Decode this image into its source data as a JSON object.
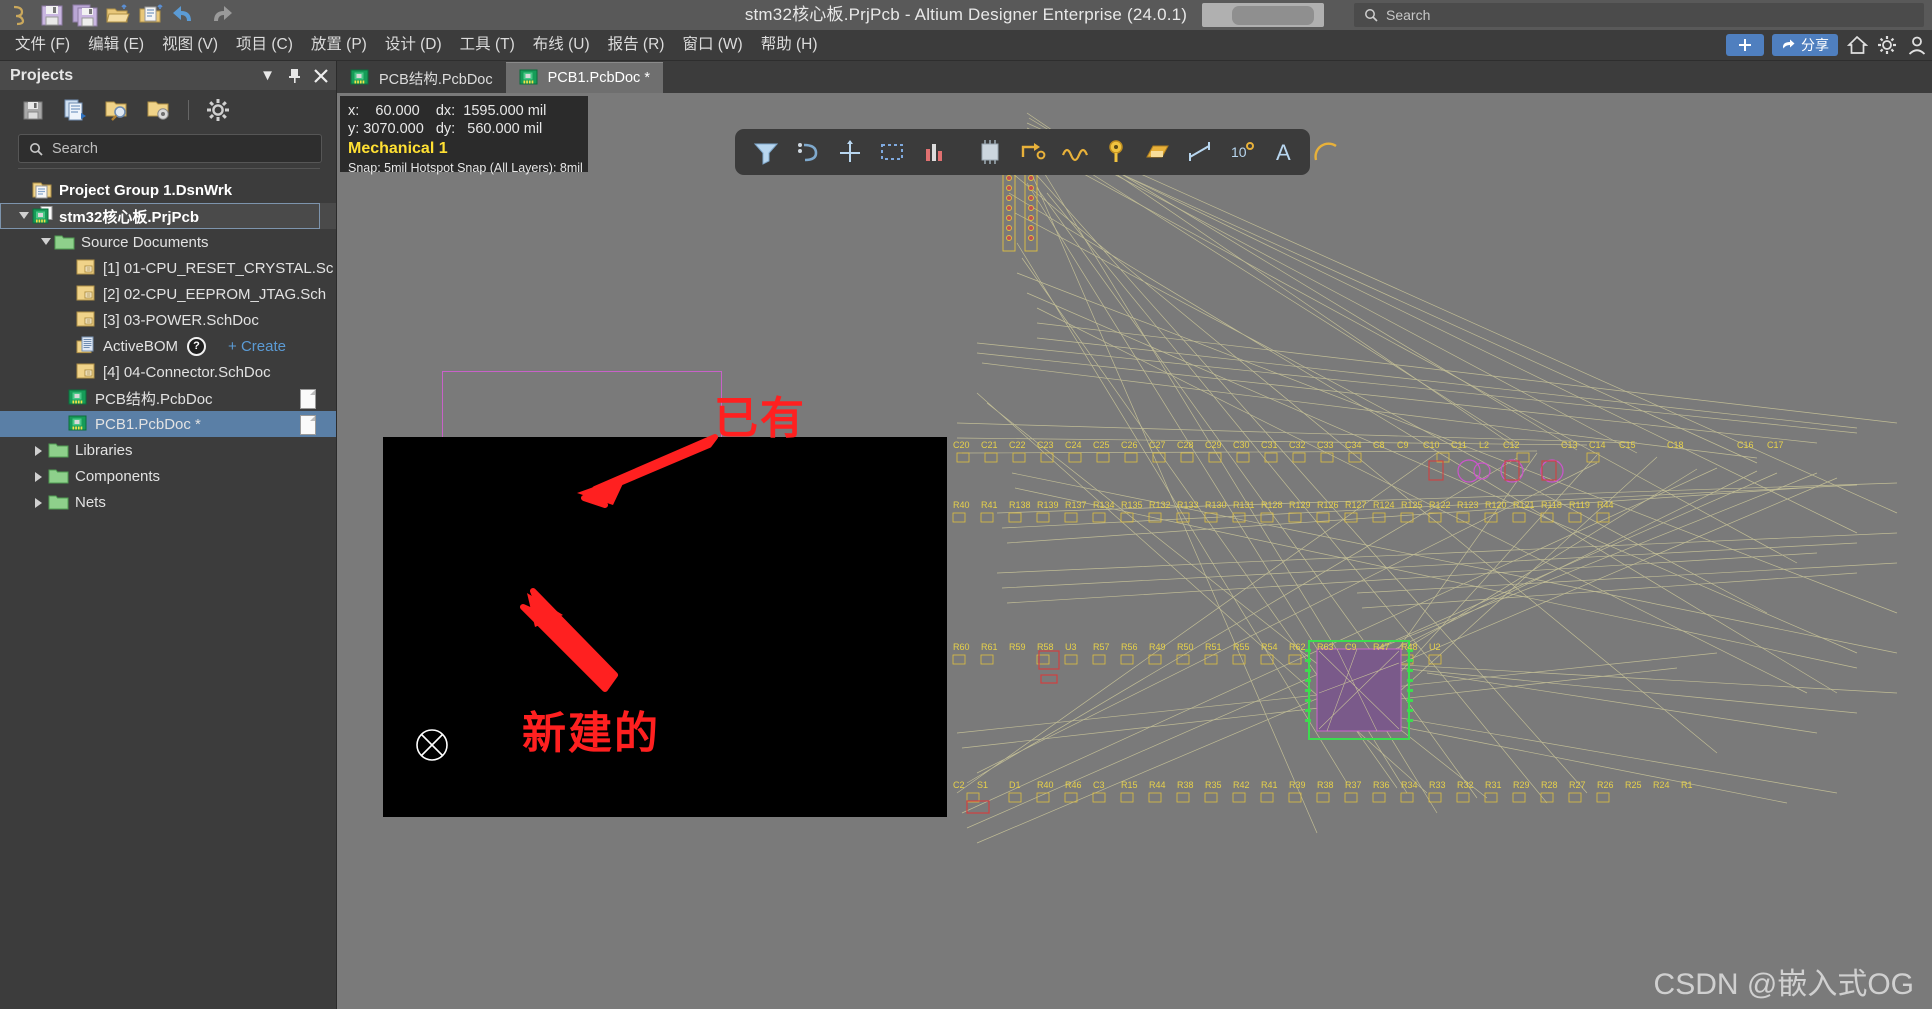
{
  "window": {
    "title": "stm32核心板.PrjPcb - Altium Designer Enterprise (24.0.1)",
    "search_placeholder": "Search"
  },
  "toolbar_top": {
    "icons": [
      "altium-logo-icon",
      "save-icon",
      "save-all-icon",
      "open-folder-icon",
      "open-document-icon",
      "undo-icon",
      "redo-icon"
    ]
  },
  "menu": {
    "items": [
      {
        "label": "文件 (F)",
        "name": "menu-file"
      },
      {
        "label": "编辑 (E)",
        "name": "menu-edit"
      },
      {
        "label": "视图 (V)",
        "name": "menu-view"
      },
      {
        "label": "项目 (C)",
        "name": "menu-project"
      },
      {
        "label": "放置 (P)",
        "name": "menu-place"
      },
      {
        "label": "设计 (D)",
        "name": "menu-design"
      },
      {
        "label": "工具 (T)",
        "name": "menu-tools"
      },
      {
        "label": "布线 (U)",
        "name": "menu-route"
      },
      {
        "label": "报告 (R)",
        "name": "menu-report"
      },
      {
        "label": "窗口 (W)",
        "name": "menu-window"
      },
      {
        "label": "帮助 (H)",
        "name": "menu-help"
      }
    ],
    "share_label": "分享"
  },
  "projects_panel": {
    "title": "Projects",
    "search_placeholder": "Search",
    "toolbar_icons": [
      "save-icon",
      "compile-documents-icon",
      "open-project-search-icon",
      "project-options-icon",
      "settings-gear-icon"
    ],
    "header_buttons": [
      "dropdown-caret",
      "pin",
      "close"
    ],
    "tree": [
      {
        "label": "Project Group 1.DsnWrk",
        "icon": "workspace-icon",
        "indent": 0,
        "twisty": "none",
        "bold": true,
        "state": "normal"
      },
      {
        "label": "stm32核心板.PrjPcb",
        "icon": "pcb-project-icon",
        "indent": 1,
        "twisty": "down",
        "bold": true,
        "state": "focus-box"
      },
      {
        "label": "Source Documents",
        "icon": "folder-green-icon",
        "indent": 2,
        "twisty": "down",
        "bold": false,
        "state": "normal"
      },
      {
        "label": "[1] 01-CPU_RESET_CRYSTAL.Sc",
        "icon": "schdoc-icon",
        "indent": 3,
        "twisty": "none",
        "bold": false,
        "state": "normal"
      },
      {
        "label": "[2] 02-CPU_EEPROM_JTAG.Sch",
        "icon": "schdoc-icon",
        "indent": 3,
        "twisty": "none",
        "bold": false,
        "state": "normal"
      },
      {
        "label": "[3] 03-POWER.SchDoc",
        "icon": "schdoc-icon",
        "indent": 3,
        "twisty": "none",
        "bold": false,
        "state": "normal"
      },
      {
        "label": "ActiveBOM",
        "icon": "activebom-icon",
        "indent": 3,
        "twisty": "none",
        "bold": false,
        "state": "normal",
        "help": "?",
        "action": "+ Create"
      },
      {
        "label": "[4] 04-Connector.SchDoc",
        "icon": "schdoc-icon",
        "indent": 3,
        "twisty": "none",
        "bold": false,
        "state": "normal"
      },
      {
        "label": "PCB结构.PcbDoc",
        "icon": "pcbdoc-icon",
        "indent": 3,
        "twisty": "none",
        "bold": false,
        "state": "normal",
        "badge": "page"
      },
      {
        "label": "PCB1.PcbDoc *",
        "icon": "pcbdoc-icon",
        "indent": 3,
        "twisty": "none",
        "bold": false,
        "state": "selected",
        "badge": "page"
      },
      {
        "label": "Libraries",
        "icon": "folder-green-icon",
        "indent": 2,
        "twisty": "right",
        "bold": false,
        "state": "normal"
      },
      {
        "label": "Components",
        "icon": "folder-green-icon",
        "indent": 2,
        "twisty": "right",
        "bold": false,
        "state": "normal"
      },
      {
        "label": "Nets",
        "icon": "folder-green-icon",
        "indent": 2,
        "twisty": "right",
        "bold": false,
        "state": "normal"
      }
    ]
  },
  "document_tabs": [
    {
      "label": "PCB结构.PcbDoc",
      "active": false,
      "icon": "pcbdoc-icon"
    },
    {
      "label": "PCB1.PcbDoc *",
      "active": true,
      "icon": "pcbdoc-icon"
    }
  ],
  "status_overlay": {
    "line1": "x:    60.000    dx:  1595.000 mil",
    "line2": "y: 3070.000   dy:   560.000 mil",
    "layer": "Mechanical 1",
    "snap": "Snap: 5mil Hotspot Snap (All Layers): 8mil"
  },
  "pcb_toolbar": {
    "icons": [
      "filter-icon",
      "net-color-icon",
      "crosshair-place-icon",
      "selection-region-icon",
      "layer-stack-icon",
      "board-region-icon",
      "route-track-icon",
      "interactive-length-tuning-icon",
      "place-via-icon",
      "place-polygon-icon",
      "place-dimension-icon",
      "place-coordinate-icon",
      "place-string-icon",
      "place-arc-icon"
    ]
  },
  "annotations": [
    {
      "text": "已有",
      "name": "annotation-existing",
      "color": "#ff2020"
    },
    {
      "text": "新建的",
      "name": "annotation-new",
      "color": "#ff2020"
    }
  ],
  "watermark": "CSDN @嵌入式OG",
  "colors": {
    "accent_blue": "#4f7fbf",
    "selection_blue": "#5a7fa6",
    "layer_yellow": "#ffe033",
    "board_outline": "#c862c8",
    "annotation_red": "#ff2020"
  }
}
